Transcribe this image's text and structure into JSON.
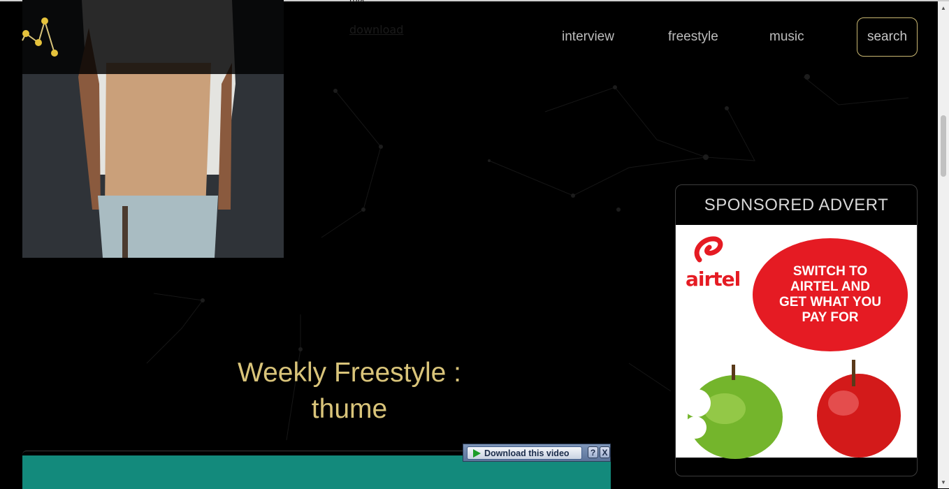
{
  "header": {
    "logo_icon": "constellation-logo-icon",
    "accent_color": "#d9c47a",
    "nav": [
      {
        "label": "interview"
      },
      {
        "label": "freestyle"
      },
      {
        "label": "music"
      }
    ],
    "search_label": "search"
  },
  "post": {
    "meta_text": "mix",
    "download_link": "download",
    "title_line1": "Weekly Freestyle :",
    "title_line2": "thume"
  },
  "video_bar": {
    "download_label": "Download this video",
    "help_label": "?",
    "close_label": "X"
  },
  "sidebar": {
    "ad_heading": "SPONSORED ADVERT",
    "ad_brand": "airtel",
    "ad_line1": "SWITCH TO",
    "ad_line2": "AIRTEL AND",
    "ad_line3": "GET WHAT YOU",
    "ad_line4": "PAY FOR",
    "ad_brand_color": "#e51b23"
  },
  "scrollbar": {
    "up_icon": "arrow-up-icon",
    "down_icon": "arrow-down-icon"
  }
}
